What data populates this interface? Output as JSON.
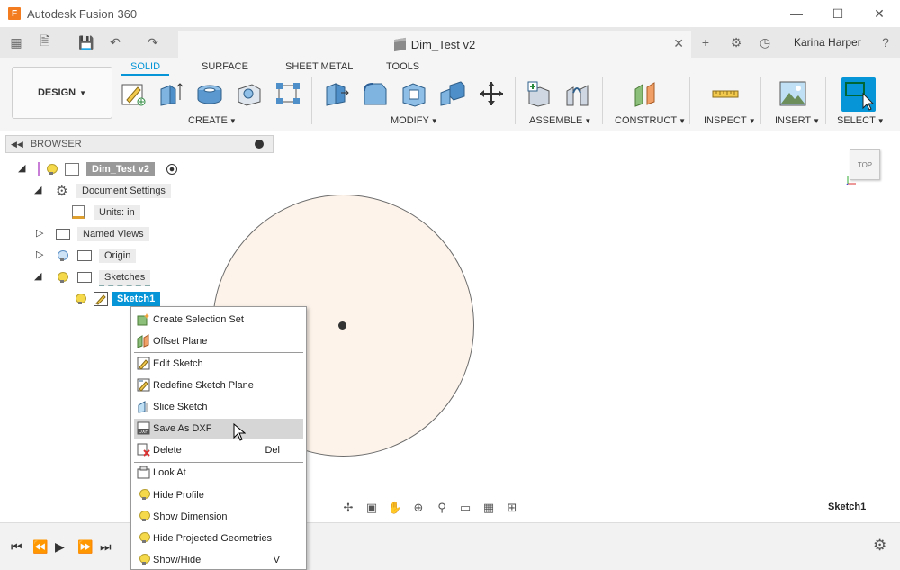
{
  "window": {
    "app_logo": "F",
    "title": "Autodesk Fusion 360"
  },
  "document_tab": {
    "title": "Dim_Test v2"
  },
  "user": {
    "name": "Karina Harper"
  },
  "ribbon": {
    "workspace": "DESIGN",
    "tabs": [
      "SOLID",
      "SURFACE",
      "SHEET METAL",
      "TOOLS"
    ],
    "groups": [
      "CREATE",
      "MODIFY",
      "ASSEMBLE",
      "CONSTRUCT",
      "INSPECT",
      "INSERT",
      "SELECT"
    ]
  },
  "browser": {
    "title": "BROWSER",
    "root": "Dim_Test v2",
    "document_settings": "Document Settings",
    "units": "Units: in",
    "named_views": "Named Views",
    "origin": "Origin",
    "sketches": "Sketches",
    "sketch1": "Sketch1"
  },
  "viewcube": {
    "face": "TOP"
  },
  "canvas": {
    "active_sketch_label": "Sketch1"
  },
  "context_menu": {
    "items": [
      {
        "label": "Create Selection Set",
        "shortcut": ""
      },
      {
        "label": "Offset Plane",
        "shortcut": ""
      },
      {
        "label": "Edit Sketch",
        "shortcut": ""
      },
      {
        "label": "Redefine Sketch Plane",
        "shortcut": ""
      },
      {
        "label": "Slice Sketch",
        "shortcut": ""
      },
      {
        "label": "Save As DXF",
        "shortcut": ""
      },
      {
        "label": "Delete",
        "shortcut": "Del"
      },
      {
        "label": "Look At",
        "shortcut": ""
      },
      {
        "label": "Hide Profile",
        "shortcut": ""
      },
      {
        "label": "Show Dimension",
        "shortcut": ""
      },
      {
        "label": "Hide Projected Geometries",
        "shortcut": ""
      },
      {
        "label": "Show/Hide",
        "shortcut": "V"
      }
    ],
    "hovered": "Save As DXF"
  },
  "colors": {
    "accent": "#0696d7",
    "sketch_fill": "#fdf3ea",
    "ribbon_bg": "#f5f5f5"
  }
}
